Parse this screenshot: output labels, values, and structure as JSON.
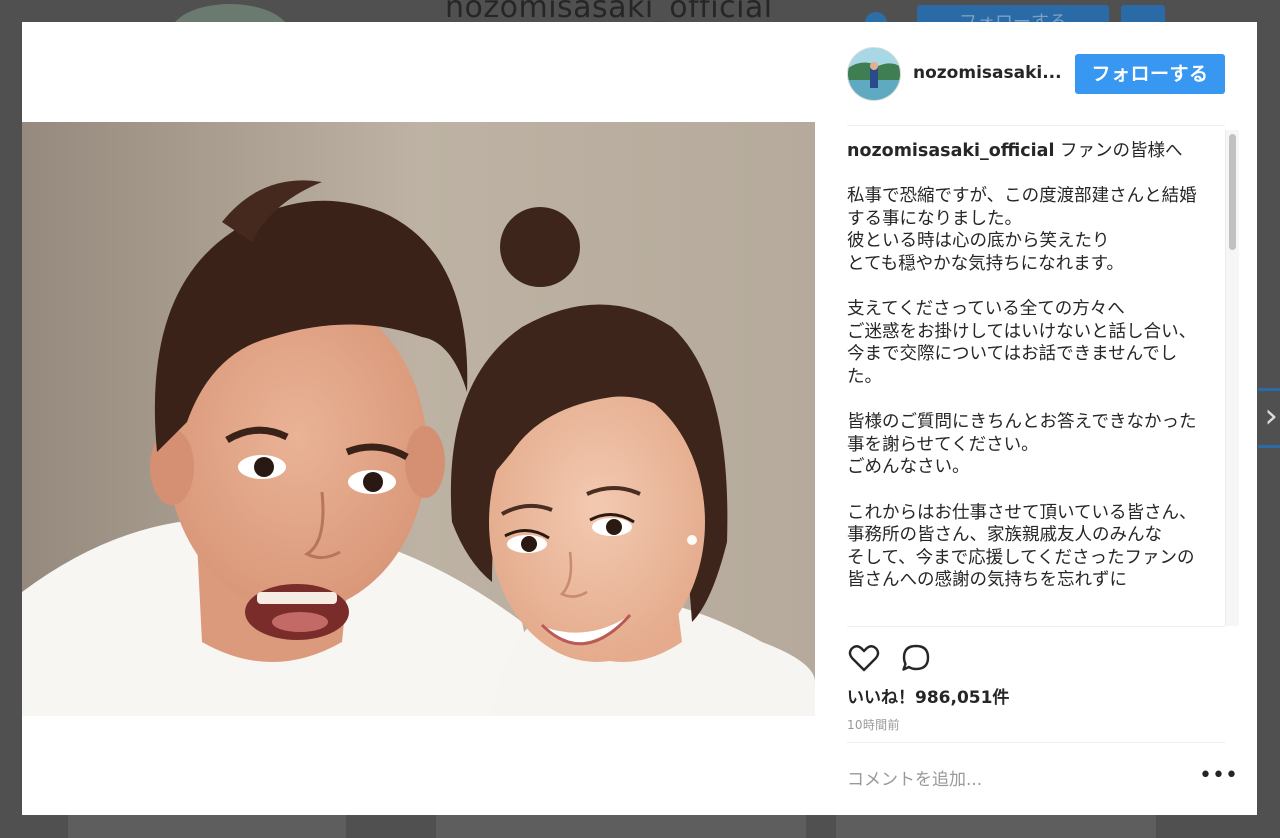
{
  "background": {
    "username": "nozomisasaki_official",
    "follow_label": "フォローする"
  },
  "post": {
    "username": "nozomisasaki...",
    "follow_label": "フォローする",
    "avatar_icon": "profile-avatar",
    "caption": {
      "username": "nozomisasaki_official",
      "text": " ファンの皆様へ\n\n私事で恐縮ですが、この度渡部建さんと結婚する事になりました。\n彼といる時は心の底から笑えたり\nとても穏やかな気持ちになれます。\n\n支えてくださっている全ての方々へ\nご迷惑をお掛けしてはいけないと話し合い、\n今まで交際についてはお話できませんでした。\n\n皆様のご質問にきちんとお答えできなかった事を謝らせてください。\nごめんなさい。\n\nこれからはお仕事させて頂いている皆さん、事務所の皆さん、家族親戚友人のみんな\nそして、今まで応援してくださったファンの皆さんへの感謝の気持ちを忘れずに"
    },
    "like_icon": "heart-icon",
    "comment_icon": "comment-bubble-icon",
    "likes": "いいね！986,051件",
    "timestamp": "10時間前",
    "comment_placeholder": "コメントを追加...",
    "more_icon": "more-dots-icon",
    "more_glyph": "•••"
  },
  "colors": {
    "accent": "#3897f0",
    "overlay": "#4a4a4a"
  }
}
